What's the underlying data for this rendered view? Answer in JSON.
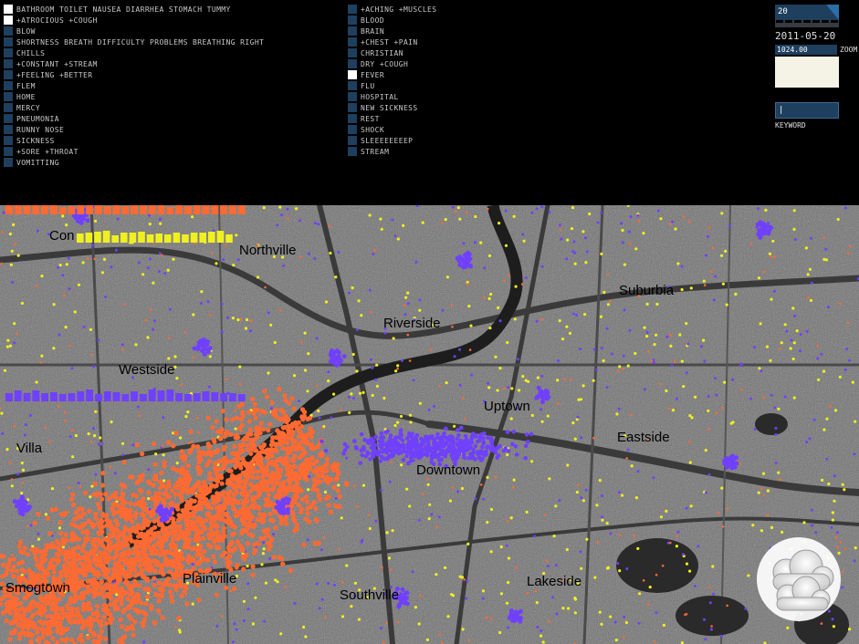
{
  "keywords_col1": [
    {
      "label": "BATHROOM TOILET NAUSEA DIARRHEA STOMACH TUMMY",
      "checked": true
    },
    {
      "label": "+ATROCIOUS +COUGH",
      "checked": true
    },
    {
      "label": "BLOW",
      "checked": false
    },
    {
      "label": "SHORTNESS BREATH DIFFICULTY PROBLEMS BREATHING RIGHT",
      "checked": false
    },
    {
      "label": "CHILLS",
      "checked": false
    },
    {
      "label": "+CONSTANT +STREAM",
      "checked": false
    },
    {
      "label": "+FEELING +BETTER",
      "checked": false
    },
    {
      "label": "FLEM",
      "checked": false
    },
    {
      "label": "HOME",
      "checked": false
    },
    {
      "label": "MERCY",
      "checked": false
    },
    {
      "label": "PNEUMONIA",
      "checked": false
    },
    {
      "label": "RUNNY NOSE",
      "checked": false
    },
    {
      "label": "SICKNESS",
      "checked": false
    },
    {
      "label": "+SORE +THROAT",
      "checked": false
    },
    {
      "label": "VOMITTING",
      "checked": false
    }
  ],
  "keywords_col2": [
    {
      "label": "+ACHING +MUSCLES",
      "checked": false
    },
    {
      "label": "BLOOD",
      "checked": false
    },
    {
      "label": "BRAIN",
      "checked": false
    },
    {
      "label": "+CHEST +PAIN",
      "checked": false
    },
    {
      "label": "CHRISTIAN",
      "checked": false
    },
    {
      "label": "DRY +COUGH",
      "checked": false
    },
    {
      "label": "FEVER",
      "checked": true
    },
    {
      "label": "FLU",
      "checked": false
    },
    {
      "label": "HOSPITAL",
      "checked": false
    },
    {
      "label": "NEW SICKNESS",
      "checked": false
    },
    {
      "label": "REST",
      "checked": false
    },
    {
      "label": "SHOCK",
      "checked": false
    },
    {
      "label": "SLEEEEEEEEP",
      "checked": false
    },
    {
      "label": "STREAM",
      "checked": false
    }
  ],
  "controls": {
    "slider_value": "20",
    "date": "2011-05-20",
    "zoom_value": "1024.00",
    "zoom_label": "ZOOM",
    "keyword_value": "|",
    "keyword_label": "KEYWORD"
  },
  "map": {
    "labels": [
      "Northville",
      "Suburbia",
      "Riverside",
      "Westside",
      "Uptown",
      "Eastside",
      "Villa",
      "Downtown",
      "Southville",
      "Lakeside",
      "Smogtown",
      "Plainville",
      "Con"
    ],
    "weather_icon": "cloud-icon"
  },
  "colors": {
    "background": "#000000",
    "checkbox": "#1e3f5e",
    "checkbox_checked": "#ffffff",
    "series_orange": "#ff6a33",
    "series_yellow": "#f0f020",
    "series_purple": "#7040ff"
  }
}
